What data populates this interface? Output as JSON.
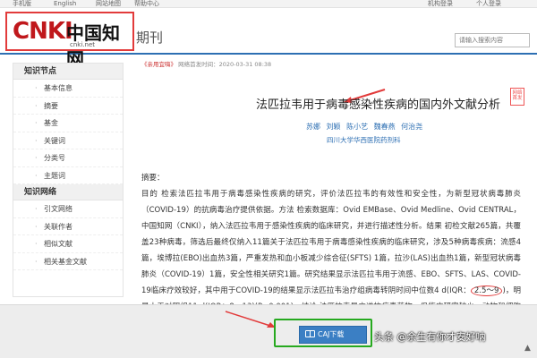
{
  "topbar": {
    "links": [
      "手机版",
      "English",
      "网站地图",
      "帮助中心"
    ],
    "org_login": "机构登录",
    "personal_login": "个人登录"
  },
  "header": {
    "logo_text": "CNKI",
    "logo_chinese": "中国知网",
    "logo_domain": "cnki.net",
    "section_title": "期刊",
    "search_placeholder": "请输入搜索内容"
  },
  "sidebar": {
    "sections": [
      {
        "title": "知识节点",
        "items": [
          "基本信息",
          "摘要",
          "基金",
          "关键词",
          "分类号",
          "主题词"
        ]
      },
      {
        "title": "知识网络",
        "items": [
          "引文网络",
          "关联作者",
          "相似文献",
          "相关基金文献"
        ]
      }
    ]
  },
  "article": {
    "source": "《亲用宜嗨》",
    "pub_note": "网络首发时间：2020-03-31  08:38",
    "title": "法匹拉韦用于病毒感染性疾病的国内外文献分析",
    "stamp": "网络首发",
    "authors": "苏娜  刘颖  陈小艺  魏春燕  何治尧",
    "affiliation": "四川大学华西医院药剂科",
    "abstract_label": "摘要：",
    "abstract_part1": "目的 检索法匹拉韦用于病毒感染性疾病的研究，评价法匹拉韦的有效性和安全性，为新型冠状病毒肺炎（COVID-19）的抗病毒治疗提供依据。方法 检索数据库：Ovid EMBase、Ovid Medline、Ovid CENTRAL，中国知网（CNKI），纳入法匹拉韦用于感染性疾病的临床研究，并进行描述性分析。结果 初检文献265篇，共覆盖23种病毒，筛选后最终仅纳入11篇关于法匹拉韦用于病毒感染性疾病的临床研究，涉及5种病毒疾病：流感4篇，埃博拉(EBO)出血热3篇，严重发热和血小板减少综合征(SFTS) 1篇，拉沙(LAS)出血热1篇，新型冠状病毒肺炎（COVID-19）1篇，安全性相关研究1篇。研究结果显示法匹拉韦用于流感、EBO、SFTS、LAS、COVID-19临床疗效较好，其中用于COVID-19的结果显示法匹拉韦治疗组病毒转阴时间中位数4 d(IQR：",
    "abstract_circled": "2.5～9",
    "abstract_part2": ")，明显小于对照组11 d(IQR：8～13)(P<0.001)。结论 法匹拉韦是广谱抗病毒药物，但临床研究较少，动物和细胞研究居多，临床研究显示其有良好的临床疗效，可以推荐用于治疗"
  },
  "bottom": {
    "caj_button": "CAJ下载",
    "watermark": "头条 @余生有你才安好呐"
  },
  "colors": {
    "brand_red": "#c0181c",
    "link_blue": "#2d6fb3",
    "button_blue": "#3b7fc4",
    "highlight_green": "#26a91f",
    "annotation_red": "#e23b3b"
  }
}
